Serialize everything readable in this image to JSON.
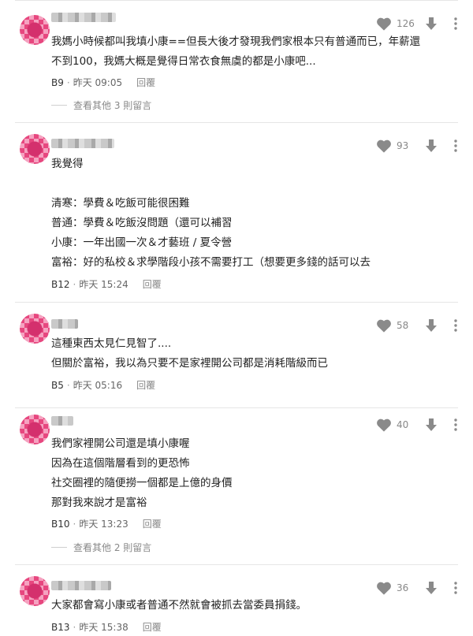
{
  "comments": [
    {
      "likes": "126",
      "lines": [
        "我媽小時候都叫我填小康==但長大後才發現我們家根本只有普通而已，年薪還",
        "不到100，我媽大概是覺得日常衣食無虞的都是小康吧..."
      ],
      "floor": "B9",
      "time": "昨天 09:05",
      "reply_label": "回覆",
      "more_replies": "查看其他 3 則留言"
    },
    {
      "likes": "93",
      "lines": [
        "我覺得",
        "",
        "清寒：學費＆吃飯可能很困難",
        "普通：學費＆吃飯沒問題（還可以補習",
        "小康：一年出國一次＆才藝班 / 夏令營",
        "富裕：好的私校＆求學階段小孩不需要打工（想要更多錢的話可以去"
      ],
      "floor": "B12",
      "time": "昨天 15:24",
      "reply_label": "回覆"
    },
    {
      "likes": "58",
      "lines": [
        "這種東西太見仁見智了....",
        "但關於富裕，我以為只要不是家裡開公司都是消耗階級而已"
      ],
      "floor": "B5",
      "time": "昨天 05:16",
      "reply_label": "回覆"
    },
    {
      "likes": "40",
      "lines": [
        "我們家裡開公司還是填小康喔",
        "因為在這個階層看到的更恐怖",
        "社交圈裡的隨便撈一個都是上億的身價",
        "那對我來說才是富裕"
      ],
      "floor": "B10",
      "time": "昨天 13:23",
      "reply_label": "回覆",
      "more_replies": "查看其他 2 則留言"
    },
    {
      "likes": "36",
      "lines": [
        "大家都會寫小康或者普通不然就會被抓去當委員捐錢。"
      ],
      "floor": "B13",
      "time": "昨天 15:38",
      "reply_label": "回覆"
    }
  ],
  "icons": {
    "like": "heart-icon",
    "dislike": "down-arrow-icon",
    "more": "more-vertical-icon"
  },
  "colors": {
    "icon_gray": "#8a8a8a",
    "avatar_pink": "#e7477f",
    "divider": "#e6e6e6"
  }
}
